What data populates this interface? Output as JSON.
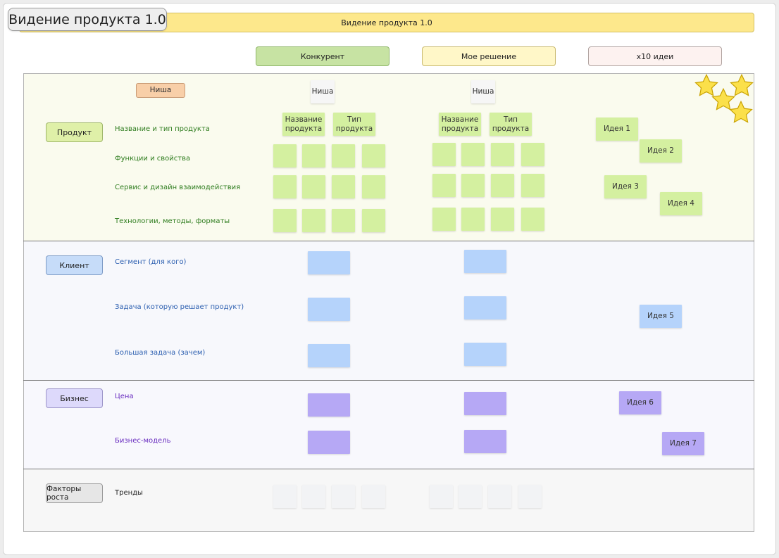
{
  "frame": {
    "title": "Видение продукта 1.0"
  },
  "banner": {
    "text": "Видение продукта 1.0"
  },
  "columns": {
    "competitor": "Конкурент",
    "my_solution": "Мое решение",
    "x10_ideas": "x10 идеи"
  },
  "sections": {
    "product": {
      "label": "Продукт",
      "niche_tag": "Ниша",
      "rows": {
        "name_type": "Название и тип продукта",
        "functions": "Функции и свойства",
        "service": "Сервис и дизайн взаимодействия",
        "tech": "Технологии, методы, форматы"
      },
      "niche_competitor": "Ниша",
      "niche_solution": "Ниша",
      "name_label": "Название продукта",
      "type_label": "Тип продукта"
    },
    "client": {
      "label": "Клиент",
      "rows": {
        "segment": "Сегмент (для кого)",
        "task": "Задача (которую решает продукт)",
        "big_task": "Большая задача (зачем)"
      }
    },
    "business": {
      "label": "Бизнес",
      "rows": {
        "price": "Цена",
        "model": "Бизнес-модель"
      }
    },
    "growth": {
      "label": "Факторы роста",
      "rows": {
        "trends": "Тренды"
      }
    }
  },
  "ideas": {
    "i1": "Идея 1",
    "i2": "Идея 2",
    "i3": "Идея 3",
    "i4": "Идея 4",
    "i5": "Идея 5",
    "i6": "Идея 6",
    "i7": "Идея 7"
  },
  "colors": {
    "product_band": "#fafbee",
    "client_band": "#f7f8fc",
    "business_band": "#f8f8fd",
    "growth_band": "#f7f7f7",
    "row_label_product": "#2f7d1f",
    "row_label_client": "#2c5fb0",
    "row_label_business": "#6a2ec0",
    "star": "#fbe04a"
  }
}
